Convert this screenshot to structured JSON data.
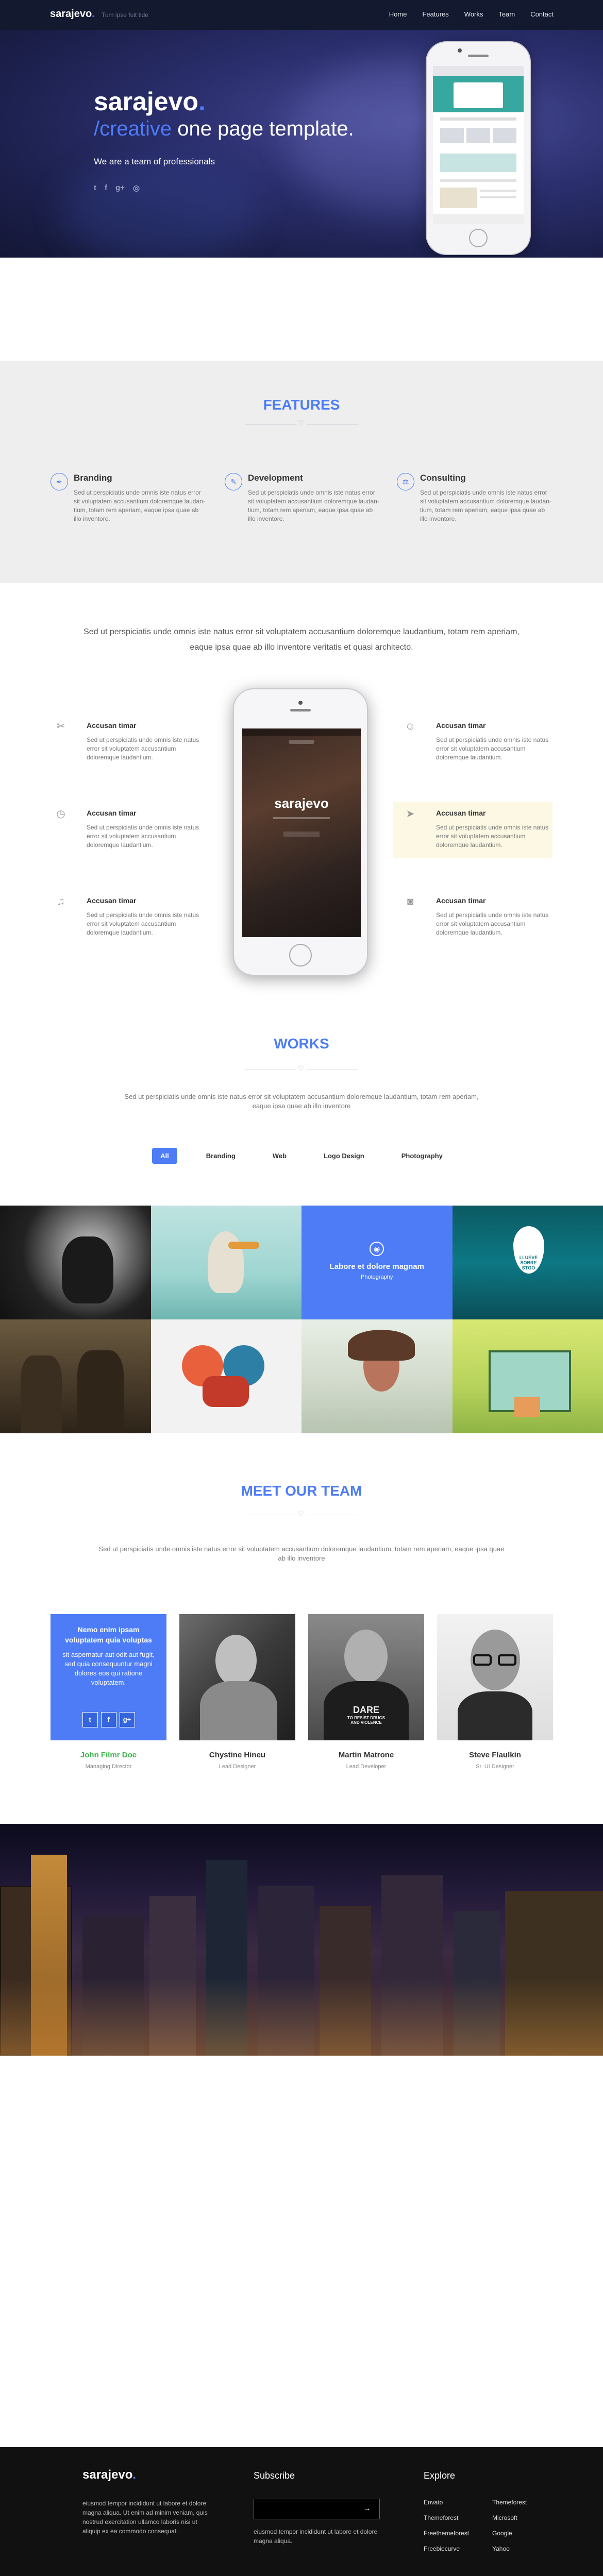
{
  "nav": {
    "brand": "sarajevo",
    "brand_dot": ".",
    "tagline": "Tum ipse fuit tide",
    "menu": [
      "Home",
      "Features",
      "Works",
      "Team",
      "Contact"
    ]
  },
  "hero": {
    "title": "sarajevo",
    "title_dot": ".",
    "subtitle_highlight": "/creative",
    "subtitle_rest": " one page template.",
    "tagline": "We are a team of professionals",
    "socials": [
      "twitter-icon",
      "facebook-icon",
      "google-plus-icon",
      "dribbble-icon"
    ]
  },
  "features": {
    "title": "FEATURES",
    "items": [
      {
        "icon": "pen-icon",
        "title": "Branding",
        "desc": "Sed ut perspiciatis unde omnis iste natus error sit voluptatem accusantium doloremque laudan-tium, totam rem aperiam, eaque ipsa quae ab illo inventore."
      },
      {
        "icon": "pencil-icon",
        "title": "Development",
        "desc": "Sed ut perspiciatis unde omnis iste natus error sit voluptatem accusantium doloremque laudan-tium, totam rem aperiam, eaque ipsa quae ab illo inventore."
      },
      {
        "icon": "diagram-icon",
        "title": "Consulting",
        "desc": "Sed ut perspiciatis unde omnis iste natus error sit voluptatem accusantium doloremque laudan-tium, totam rem aperiam, eaque ipsa quae ab illo inventore."
      }
    ]
  },
  "intro": {
    "text": "Sed ut perspiciatis unde omnis iste natus error sit voluptatem accusantium doloremque laudantium, totam rem aperiam, eaque ipsa quae ab illo inventore veritatis et quasi architecto."
  },
  "app_features": {
    "phone_brand": "sarajevo",
    "items": [
      {
        "icon": "tools-icon",
        "title": "Accusan timar",
        "desc": "Sed ut perspiciatis unde omnis iste natus error sit voluptatem accusantium doloremque laudantium."
      },
      {
        "icon": "user-icon",
        "title": "Accusan timar",
        "desc": "Sed ut perspiciatis unde omnis iste natus error sit voluptatem accusantium doloremque laudantium."
      },
      {
        "icon": "clock-icon",
        "title": "Accusan timar",
        "desc": "Sed ut perspiciatis unde omnis iste natus error sit voluptatem accusantium doloremque laudantium."
      },
      {
        "icon": "send-icon",
        "title": "Accusan timar",
        "desc": "Sed ut perspiciatis unde omnis iste natus error sit voluptatem accusantium doloremque laudantium."
      },
      {
        "icon": "music-icon",
        "title": "Accusan timar",
        "desc": "Sed ut perspiciatis unde omnis iste natus error sit voluptatem accusantium doloremque laudantium."
      },
      {
        "icon": "camera-icon",
        "title": "Accusan timar",
        "desc": "Sed ut perspiciatis unde omnis iste natus error sit voluptatem accusantium doloremque laudantium."
      }
    ]
  },
  "works": {
    "title": "WORKS",
    "desc": "Sed ut perspiciatis unde omnis iste natus error sit voluptatem accusantium doloremque laudantium, totam rem aperiam, eaque ipsa quae ab illo inventore",
    "filters": [
      "All",
      "Branding",
      "Web",
      "Logo Design",
      "Photography"
    ],
    "featured_title": "Labore et dolore magnam",
    "featured_sub": "Photography",
    "drop_text": [
      "LLUEVE",
      "SOBRE",
      "STGO"
    ]
  },
  "team": {
    "title": "MEET OUR TEAM",
    "desc": "Sed ut perspiciatis unde omnis iste natus error sit voluptatem accusantium doloremque laudantium, totam rem aperiam, eaque ipsa quae ab illo inventore",
    "overlay_title": "Nemo enim ipsam voluptatem quia voluptas",
    "overlay_desc": "sit aspernatur aut odit aut fugit, sed quia consequuntur magni dolores eos qui ratione voluptatem.",
    "shirt_text": [
      "DARE",
      "TO RESIST DRUGS",
      "AND VIOLENCE"
    ],
    "members": [
      {
        "name": "John Filmr Doe",
        "role": "Managing Director"
      },
      {
        "name": "Chystine Hineu",
        "role": "Lead Designer"
      },
      {
        "name": "Martin Matrone",
        "role": "Lead Developer"
      },
      {
        "name": "Steve Flaulkin",
        "role": "Sr. UI Designer"
      }
    ]
  },
  "footer": {
    "brand": "sarajevo",
    "brand_dot": ".",
    "desc": "eiusmod tempor incididunt ut labore et dolore magna aliqua. Ut enim ad minim veniam, quis nostrud exercitation ullamco laboris nisi ut aliquip ex ea commodo consequat.",
    "subscribe_title": "Subscribe",
    "subscribe_button": "→",
    "subscribe_desc": "eiusmod tempor incididunt ut labore et dolore magna aliqua.",
    "explore_title": "Explore",
    "links_col1": [
      "Envato",
      "Themeforest",
      "Freethemeforest",
      "Freebiecurve"
    ],
    "links_col2": [
      "Themeforest",
      "Microsoft",
      "Google",
      "Yahoo"
    ]
  },
  "colors": {
    "accent": "#4d7cf6",
    "nav_bg": "#131a30",
    "footer_bg": "#111111",
    "green": "#3fb54d"
  }
}
